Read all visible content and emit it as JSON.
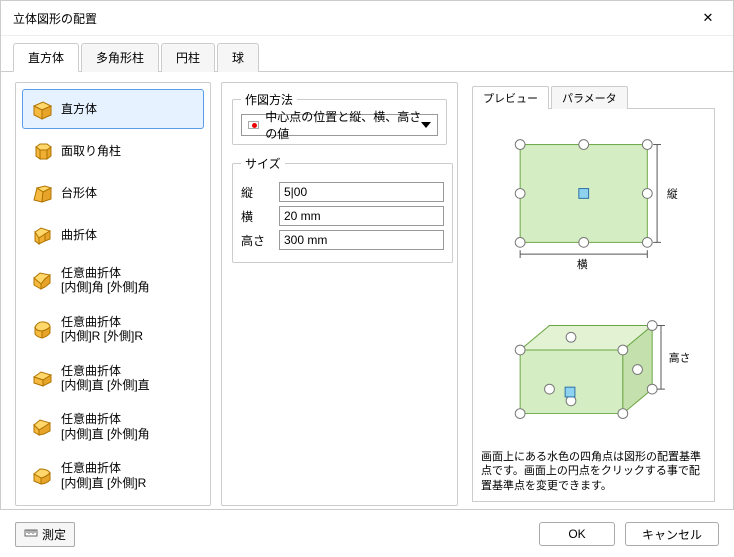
{
  "dialog": {
    "title": "立体図形の配置"
  },
  "tabs": {
    "items": [
      {
        "label": "直方体"
      },
      {
        "label": "多角形柱"
      },
      {
        "label": "円柱"
      },
      {
        "label": "球"
      }
    ]
  },
  "shapes": {
    "items": [
      {
        "label": "直方体"
      },
      {
        "label": "面取り角柱"
      },
      {
        "label": "台形体"
      },
      {
        "label": "曲折体"
      },
      {
        "label": "任意曲折体\n[内側]角 [外側]角"
      },
      {
        "label": "任意曲折体\n[内側]R [外側]R"
      },
      {
        "label": "任意曲折体\n[内側]直 [外側]直"
      },
      {
        "label": "任意曲折体\n[内側]直 [外側]角"
      },
      {
        "label": "任意曲折体\n[内側]直 [外側]R"
      }
    ]
  },
  "method": {
    "legend": "作図方法",
    "selected": "中心点の位置と縦、横、高さの値"
  },
  "size": {
    "legend": "サイズ",
    "rows": [
      {
        "label": "縦",
        "value": "5|00"
      },
      {
        "label": "横",
        "value": "20 mm"
      },
      {
        "label": "高さ",
        "value": "300 mm"
      }
    ]
  },
  "preview": {
    "tabs": [
      {
        "label": "プレビュー"
      },
      {
        "label": "パラメータ"
      }
    ],
    "dims": {
      "width": "横",
      "depth": "縦",
      "height": "高さ"
    },
    "help": "画面上にある水色の四角点は図形の配置基準点です。画面上の円点をクリックする事で配置基準点を変更できます。"
  },
  "footer": {
    "measure": "測定",
    "ok": "OK",
    "cancel": "キャンセル"
  }
}
